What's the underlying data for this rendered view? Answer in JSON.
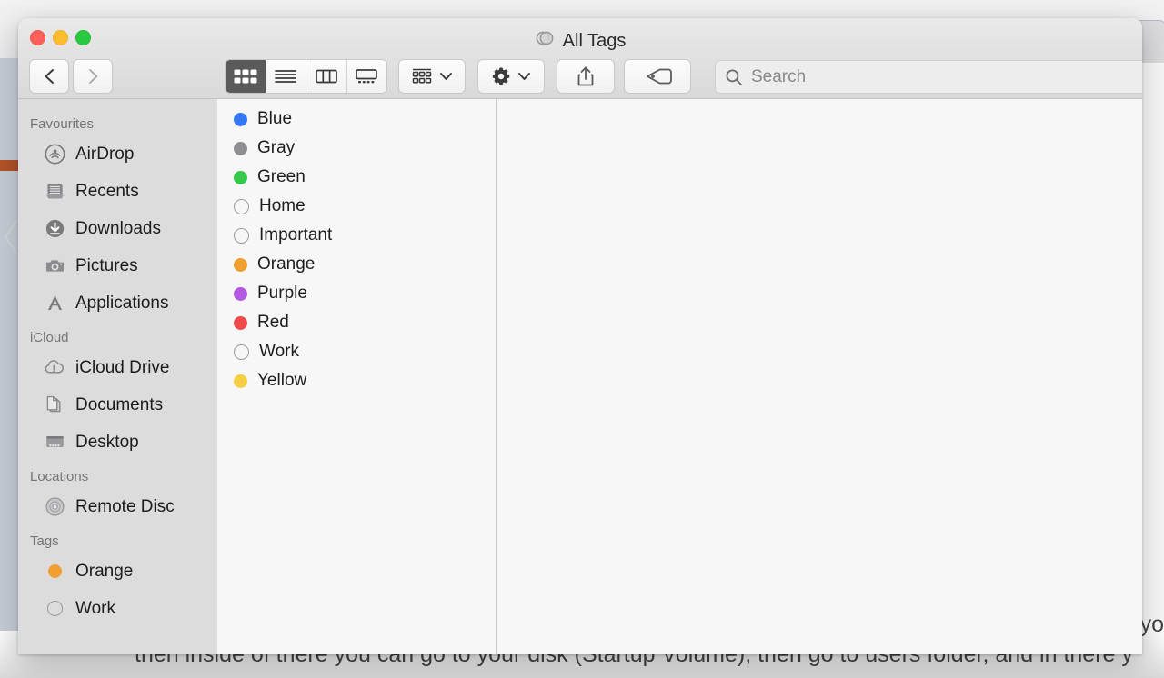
{
  "window": {
    "title": "All Tags",
    "title_icon": "tags-overlapping-circles-icon",
    "traffic_lights": [
      "close",
      "minimize",
      "zoom"
    ]
  },
  "toolbar": {
    "back_label": "Back",
    "forward_label": "Forward",
    "view_modes": [
      {
        "name": "icon-view",
        "label": "Icon View",
        "active": true
      },
      {
        "name": "list-view",
        "label": "List View",
        "active": false
      },
      {
        "name": "column-view",
        "label": "Column View",
        "active": false
      },
      {
        "name": "gallery-view",
        "label": "Gallery View",
        "active": false
      }
    ],
    "arrange_label": "Arrange By",
    "action_label": "Action",
    "share_label": "Share",
    "tags_label": "Edit Tags"
  },
  "search": {
    "placeholder": "Search",
    "value": ""
  },
  "sidebar": {
    "sections": [
      {
        "heading": "Favourites",
        "items": [
          {
            "label": "AirDrop",
            "icon": "airdrop-icon"
          },
          {
            "label": "Recents",
            "icon": "recents-icon"
          },
          {
            "label": "Downloads",
            "icon": "downloads-icon"
          },
          {
            "label": "Pictures",
            "icon": "pictures-camera-icon"
          },
          {
            "label": "Applications",
            "icon": "applications-icon"
          }
        ]
      },
      {
        "heading": "iCloud",
        "items": [
          {
            "label": "iCloud Drive",
            "icon": "icloud-drive-alert-icon"
          },
          {
            "label": "Documents",
            "icon": "documents-icon"
          },
          {
            "label": "Desktop",
            "icon": "desktop-icon"
          }
        ]
      },
      {
        "heading": "Locations",
        "items": [
          {
            "label": "Remote Disc",
            "icon": "remote-disc-icon"
          }
        ]
      },
      {
        "heading": "Tags",
        "items": [
          {
            "label": "Orange",
            "icon": "tag-dot-icon",
            "color": "#F0A030"
          },
          {
            "label": "Work",
            "icon": "tag-dot-icon",
            "color": ""
          }
        ]
      }
    ]
  },
  "tag_list": {
    "items": [
      {
        "label": "Blue",
        "color": "#3478F6"
      },
      {
        "label": "Gray",
        "color": "#8E8E93"
      },
      {
        "label": "Green",
        "color": "#34C94B"
      },
      {
        "label": "Home",
        "color": ""
      },
      {
        "label": "Important",
        "color": ""
      },
      {
        "label": "Orange",
        "color": "#F0A030"
      },
      {
        "label": "Purple",
        "color": "#B45AE0"
      },
      {
        "label": "Red",
        "color": "#EE4B4B"
      },
      {
        "label": "Work",
        "color": ""
      },
      {
        "label": "Yellow",
        "color": "#F5CE42"
      }
    ]
  },
  "background": {
    "bottom_text": "then inside of there you can go to your disk (Startup Volume), then go to users folder, and in there y",
    "bottom_right_word": "yo"
  },
  "colors": {
    "accent_blue": "#3478F6",
    "window_chrome": "#E4E4E4",
    "sidebar_bg": "#DCDCDC",
    "list_bg": "#F7F7F7",
    "active_segment": "#5A5A5A",
    "background_bar_orange": "#B4542A"
  }
}
